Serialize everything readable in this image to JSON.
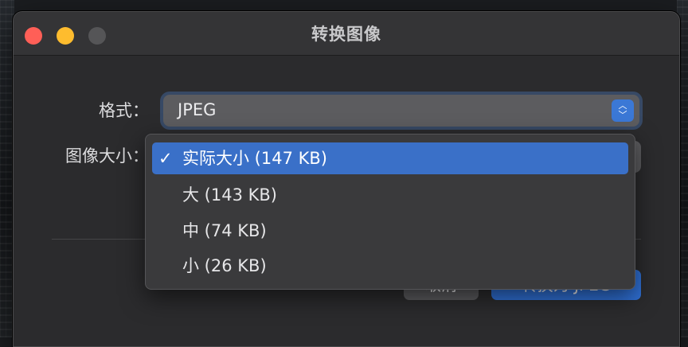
{
  "window": {
    "title": "转换图像"
  },
  "form": {
    "format_label": "格式：",
    "format_value": "JPEG",
    "size_label": "图像大小："
  },
  "size_menu": {
    "items": [
      {
        "label": "实际大小 (147 KB)",
        "checked": true
      },
      {
        "label": "大 (143 KB)",
        "checked": false
      },
      {
        "label": "中 (74 KB)",
        "checked": false
      },
      {
        "label": "小 (26 KB)",
        "checked": false
      }
    ],
    "check_glyph": "✓"
  },
  "buttons": {
    "cancel_label": "取消",
    "convert_label": "转换为 JPEG"
  },
  "colors": {
    "accent": "#3a70c8",
    "close": "#ff5f57",
    "minimize": "#febc2e"
  }
}
